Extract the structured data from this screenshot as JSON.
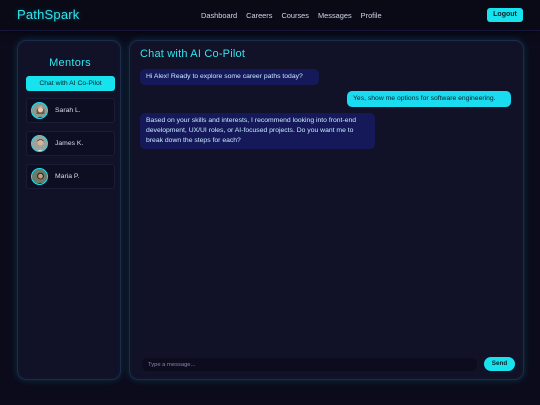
{
  "brand": "PathSpark",
  "nav": [
    "Dashboard",
    "Careers",
    "Courses",
    "Messages",
    "Profile"
  ],
  "logout_label": "Logout",
  "sidebar": {
    "title": "Mentors",
    "ai_button": "Chat with AI Co-Pilot",
    "mentors": [
      {
        "name": "Sarah L."
      },
      {
        "name": "James K."
      },
      {
        "name": "Maria P."
      }
    ]
  },
  "chat": {
    "title": "Chat with AI Co-Pilot",
    "messages": [
      {
        "from": "ai",
        "text": "Hi Alex! Ready to explore some career paths today?"
      },
      {
        "from": "user",
        "text": "Yes, show me options for software engineering."
      },
      {
        "from": "ai",
        "text": "Based on your skills and interests, I recommend looking into front-end development, UX/UI roles, or AI-focused projects. Do you want me to break down the steps for each?"
      }
    ],
    "input_placeholder": "Type a message...",
    "send_label": "Send"
  },
  "colors": {
    "accent": "#17e3ef",
    "background": "#0b0b1c",
    "panel": "#111127",
    "ai_bubble": "#15195a"
  }
}
